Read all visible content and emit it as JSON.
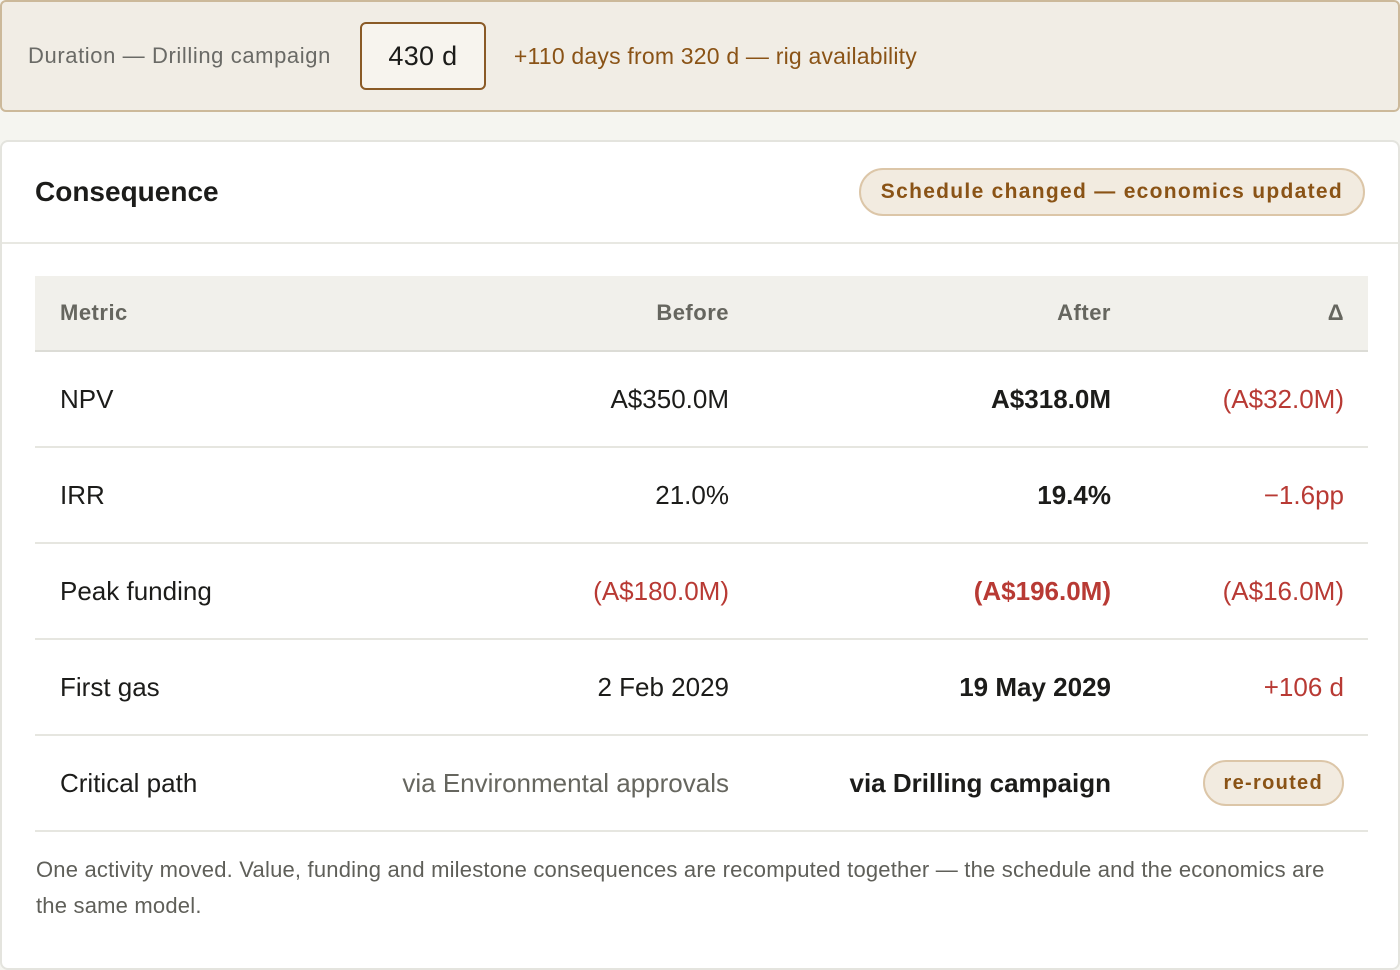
{
  "duration": {
    "label": "Duration — Drilling campaign",
    "value": "430 d",
    "delta_note": "+110 days from 320 d — rig availability"
  },
  "consequence": {
    "title": "Consequence",
    "status": "Schedule changed — economics updated",
    "headers": {
      "metric": "Metric",
      "before": "Before",
      "after": "After",
      "delta": "Δ"
    },
    "rows": [
      {
        "metric": "NPV",
        "before": "A$350.0M",
        "after": "A$318.0M",
        "delta": "(A$32.0M)"
      },
      {
        "metric": "IRR",
        "before": "21.0%",
        "after": "19.4%",
        "delta": "−1.6pp"
      },
      {
        "metric": "Peak funding",
        "before": "(A$180.0M)",
        "after": "(A$196.0M)",
        "delta": "(A$16.0M)"
      },
      {
        "metric": "First gas",
        "before": "2 Feb 2029",
        "after": "19 May 2029",
        "delta": "+106 d"
      },
      {
        "metric": "Critical path",
        "before": "via Environmental approvals",
        "after": "via Drilling campaign",
        "delta": "re-routed"
      }
    ],
    "footnote": "One activity moved. Value, funding and milestone consequences are recomputed together — the schedule and the economics are the same model."
  },
  "colors": {
    "accent": "#8a5316",
    "negative": "#b83a34",
    "input_border": "#8a5a26"
  }
}
